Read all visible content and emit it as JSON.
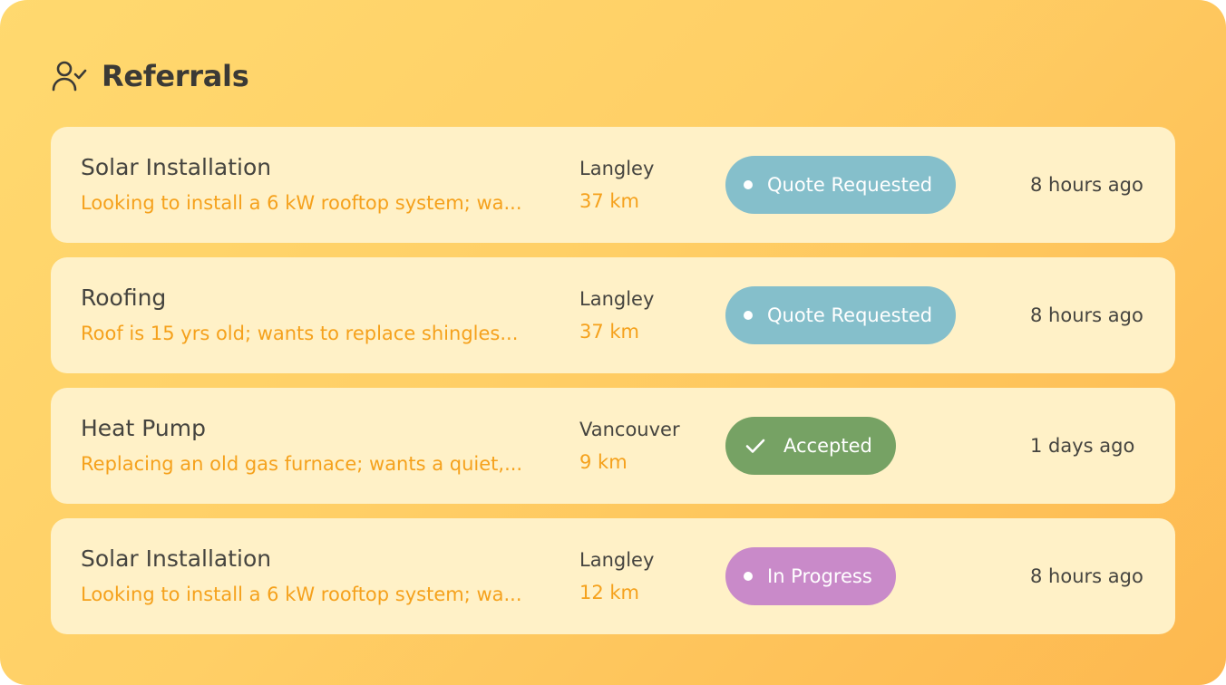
{
  "header": {
    "title": "Referrals",
    "icon": "user-check-icon"
  },
  "colors": {
    "background_gradient_start": "#ffd96f",
    "background_gradient_end": "#fdb84f",
    "card_background": "#fff1c7",
    "accent_orange": "#f5a11c",
    "status_quote_requested": "#85bfcb",
    "status_accepted": "#76a264",
    "status_in_progress": "#c98ac9"
  },
  "referrals": [
    {
      "title": "Solar Installation",
      "description": "Looking to install a 6 kW rooftop system; wa...",
      "city": "Langley",
      "distance": "37 km",
      "status": "Quote Requested",
      "status_icon": "dot-icon",
      "time": "8 hours ago"
    },
    {
      "title": "Roofing",
      "description": "Roof is 15 yrs old; wants to replace shingles...",
      "city": "Langley",
      "distance": "37 km",
      "status": "Quote Requested",
      "status_icon": "dot-icon",
      "time": "8 hours ago"
    },
    {
      "title": "Heat Pump",
      "description": "Replacing an old gas furnace; wants a quiet,...",
      "city": "Vancouver",
      "distance": "9 km",
      "status": "Accepted",
      "status_icon": "check-icon",
      "time": "1 days ago"
    },
    {
      "title": "Solar Installation",
      "description": "Looking to install a 6 kW rooftop system; wa...",
      "city": "Langley",
      "distance": "12 km",
      "status": "In Progress",
      "status_icon": "dot-icon",
      "time": "8 hours ago"
    }
  ]
}
